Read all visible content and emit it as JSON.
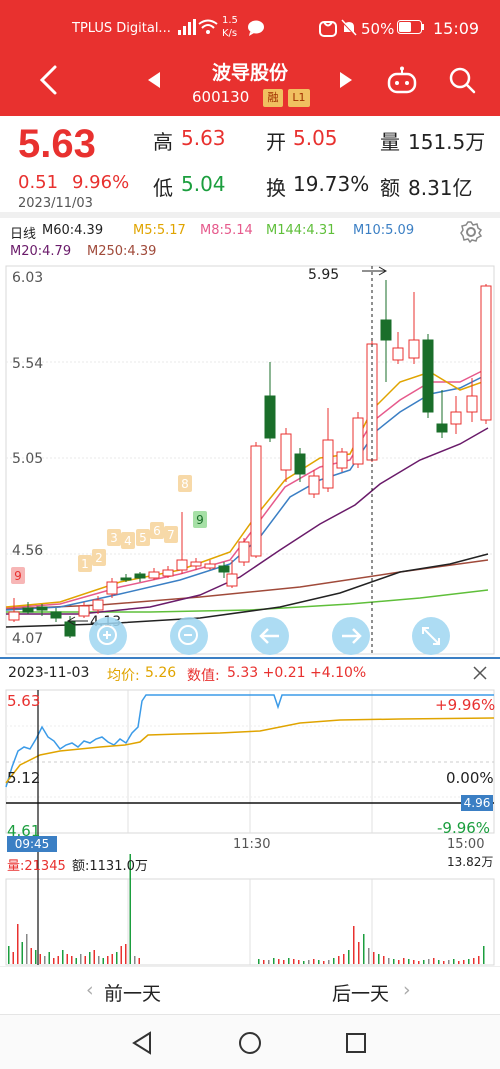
{
  "status": {
    "carrier": "TPLUS Digital...",
    "net_speed": "1.5",
    "net_unit": "K/s",
    "battery": "50%",
    "time": "15:09"
  },
  "header": {
    "title": "波导股份",
    "code": "600130",
    "tag1": "融",
    "tag2": "L1"
  },
  "quote": {
    "price": "5.63",
    "change": "0.51",
    "change_pct": "9.96%",
    "date": "2023/11/03",
    "high_label": "高",
    "high": "5.63",
    "open_label": "开",
    "open": "5.05",
    "vol_label": "量",
    "vol": "151.5万",
    "low_label": "低",
    "low": "5.04",
    "turn_label": "换",
    "turn": "19.73%",
    "amt_label": "额",
    "amt": "8.31亿"
  },
  "kline": {
    "period": "日线",
    "ma": [
      {
        "label": "M60:4.39",
        "color": "#222222"
      },
      {
        "label": "M5:5.17",
        "color": "#e0a400"
      },
      {
        "label": "M8:5.14",
        "color": "#e65a8c"
      },
      {
        "label": "M144:4.31",
        "color": "#5fbf3a"
      },
      {
        "label": "M10:5.09",
        "color": "#3b7fc4"
      },
      {
        "label": "M20:4.79",
        "color": "#6a1b6a"
      },
      {
        "label": "M250:4.39",
        "color": "#a04a3a"
      }
    ],
    "y_ticks": [
      "6.03",
      "5.54",
      "5.05",
      "4.56",
      "4.07"
    ],
    "high_mark": "5.95",
    "low_mark": "4.13",
    "seq_labels": [
      "9",
      "1",
      "2",
      "3",
      "4",
      "5",
      "6",
      "7",
      "8",
      "9"
    ]
  },
  "intraday": {
    "date": "2023-11-03",
    "avg_label": "均价:",
    "avg": "5.26",
    "val_label": "数值:",
    "val": "5.33 +0.21 +4.10%",
    "top_price": "5.63",
    "mid_price": "5.12",
    "bot_price": "4.61",
    "top_pct": "+9.96%",
    "mid_pct": "0.00%",
    "bot_pct": "-9.96%",
    "cursor_price": "4.96",
    "cursor_time": "09:45",
    "time_mid": "11:30",
    "time_end": "15:00",
    "vol_label": "量:21345",
    "amt_label": "额:1131.0万",
    "vol_max": "13.82万"
  },
  "day_nav": {
    "prev": "前一天",
    "next": "后一天"
  }
}
